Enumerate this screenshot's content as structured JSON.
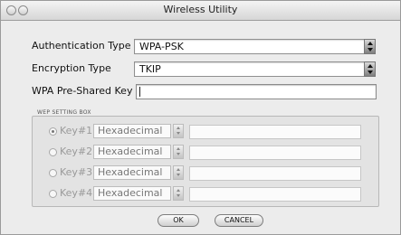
{
  "window": {
    "title": "Wireless Utility"
  },
  "form": {
    "auth_label": "Authentication Type",
    "auth_value": "WPA-PSK",
    "enc_label": "Encryption Type",
    "enc_value": "TKIP",
    "psk_label": "WPA Pre-Shared Key",
    "psk_value": ""
  },
  "wep": {
    "box_label": "WEP SETTING BOX",
    "keys": [
      {
        "label": "Key#1",
        "format": "Hexadecimal",
        "value": "",
        "selected": true
      },
      {
        "label": "Key#2",
        "format": "Hexadecimal",
        "value": "",
        "selected": false
      },
      {
        "label": "Key#3",
        "format": "Hexadecimal",
        "value": "",
        "selected": false
      },
      {
        "label": "Key#4",
        "format": "Hexadecimal",
        "value": "",
        "selected": false
      }
    ]
  },
  "buttons": {
    "ok": "OK",
    "cancel": "CANCEL"
  }
}
